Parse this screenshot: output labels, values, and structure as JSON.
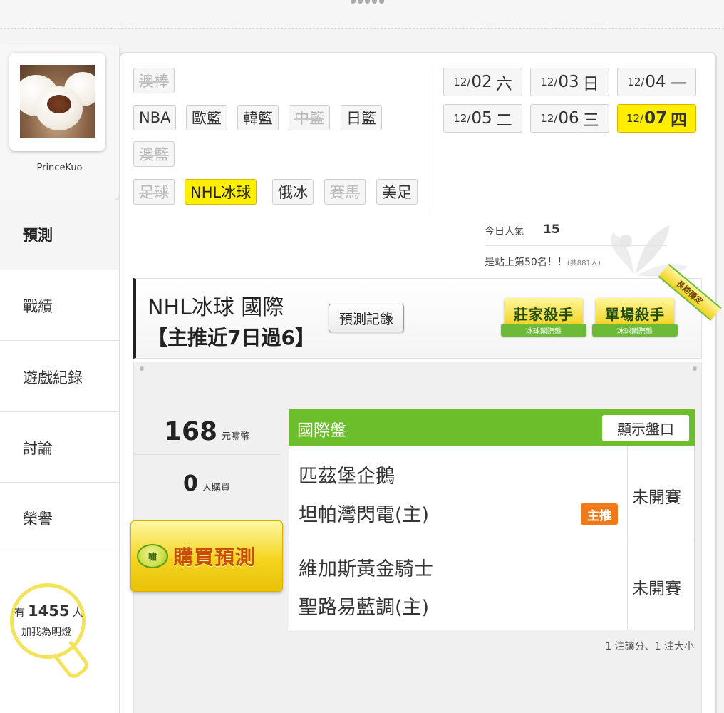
{
  "profile": {
    "username": "PrinceKuo",
    "avatar_alt": "avatar-photo"
  },
  "nav": [
    {
      "label": "預測"
    },
    {
      "label": "戰績"
    },
    {
      "label": "遊戲紀錄"
    },
    {
      "label": "討論"
    },
    {
      "label": "榮譽"
    }
  ],
  "fans": {
    "prefix": "有",
    "count": "1455",
    "suffix": "人",
    "line2": "加我為明燈"
  },
  "sports": [
    {
      "label": "澳棒"
    },
    {
      "label": "NBA"
    },
    {
      "label": "歐籃"
    },
    {
      "label": "韓籃"
    },
    {
      "label": "中籃"
    },
    {
      "label": "日籃"
    },
    {
      "label": "澳籃"
    },
    {
      "label": "足球"
    },
    {
      "label": "NHL冰球"
    },
    {
      "label": "俄冰"
    },
    {
      "label": "賽馬"
    },
    {
      "label": "美足"
    }
  ],
  "dates": [
    {
      "md": "12/",
      "d": "02",
      "wd": "六"
    },
    {
      "md": "12/",
      "d": "03",
      "wd": "日"
    },
    {
      "md": "12/",
      "d": "04",
      "wd": "一"
    },
    {
      "md": "12/",
      "d": "05",
      "wd": "二"
    },
    {
      "md": "12/",
      "d": "06",
      "wd": "三"
    },
    {
      "md": "12/",
      "d": "07",
      "wd": "四"
    }
  ],
  "popularity": {
    "label": "今日人氣",
    "value": "15",
    "rank_text": "是站上第50名！！",
    "rank_total": "(共881人)"
  },
  "header": {
    "title": "NHL冰球 國際",
    "subtitle": "【主推近7日過6】",
    "record_button": "預測記錄",
    "medals": [
      {
        "title": "莊家殺手",
        "sub": "冰球國際盤"
      },
      {
        "title": "單場殺手",
        "sub": "冰球國際盤"
      }
    ],
    "ribbon": "長期穩定"
  },
  "purchase": {
    "price": "168",
    "price_unit": "元嘯幣",
    "buyers": "0",
    "buyers_unit": "人購買",
    "coin_label": "嘯",
    "buy_label": "購買預測"
  },
  "match": {
    "title": "國際盤",
    "show_button": "顯示盤口",
    "games": [
      {
        "away": "匹茲堡企鵝",
        "home": "坦帕灣閃電(主)",
        "status": "未開賽",
        "badge": "主推"
      },
      {
        "away": "維加斯黃金騎士",
        "home": "聖路易藍調(主)",
        "status": "未開賽"
      }
    ],
    "footnote": "1 注讓分、1 注大小"
  },
  "colors": {
    "accent_yellow": "#ffee00",
    "header_green": "#6cbf2a",
    "badge_orange": "#f07a1a",
    "bulb_yellow": "#f3e35a"
  }
}
